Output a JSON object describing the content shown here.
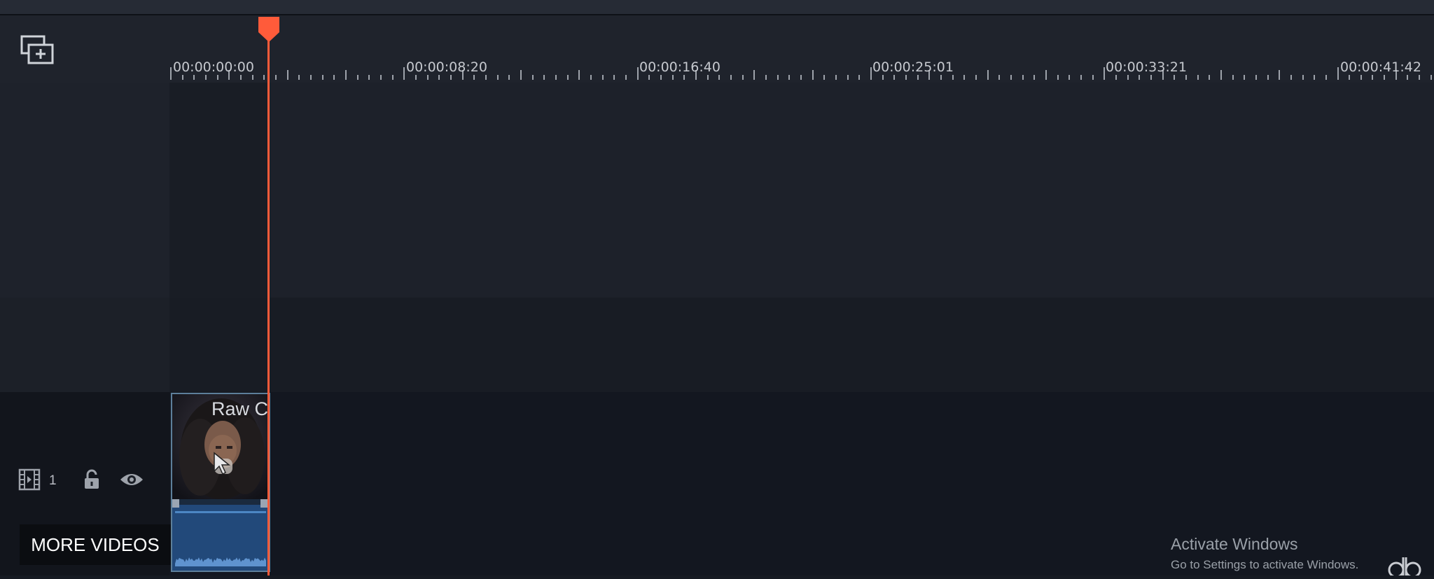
{
  "timeline": {
    "add_track_icon": "add-track-icon",
    "ruler_labels": [
      "00:00:00:00",
      "00:00:08:20",
      "00:00:16:40",
      "00:00:25:01",
      "00:00:33:21",
      "00:00:41:42"
    ],
    "playhead_color": "#ff5b3a"
  },
  "track": {
    "number": "1",
    "video_icon": "film-strip-icon",
    "lock_icon": "unlock-icon",
    "visibility_icon": "eye-icon"
  },
  "clip": {
    "title": "Raw C",
    "thumbnail": "person-portrait-thumbnail"
  },
  "overlay": {
    "more_videos": "MORE VIDEOS"
  },
  "system": {
    "activate_title": "Activate Windows",
    "activate_subtitle": "Go to Settings to activate Windows."
  }
}
